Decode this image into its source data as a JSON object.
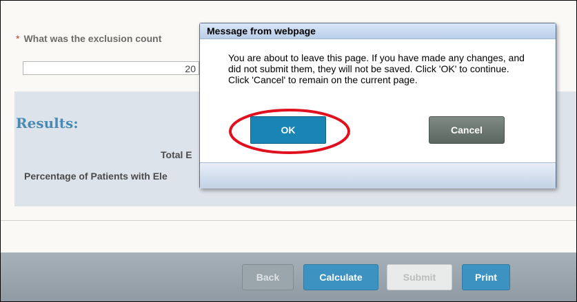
{
  "page": {
    "question": {
      "required_mark": "*",
      "label": "What was the exclusion count",
      "value": "20"
    },
    "results": {
      "title": "Results:",
      "label_1": "Total E",
      "label_2": "Percentage of Patients with Ele"
    },
    "footer": {
      "back_label": "Back",
      "calculate_label": "Calculate",
      "submit_label": "Submit",
      "print_label": "Print"
    }
  },
  "dialog": {
    "title": "Message from webpage",
    "message": "You are about to leave this page. If you have made any changes, and did not submit them, they will not be saved. Click 'OK' to continue. Click 'Cancel' to remain on the current page.",
    "ok_label": "OK",
    "cancel_label": "Cancel",
    "highlight_color": "#e0101e"
  },
  "colors": {
    "accent": "#1985b5",
    "results_title": "#4a8ab2",
    "required": "#c0392b"
  }
}
